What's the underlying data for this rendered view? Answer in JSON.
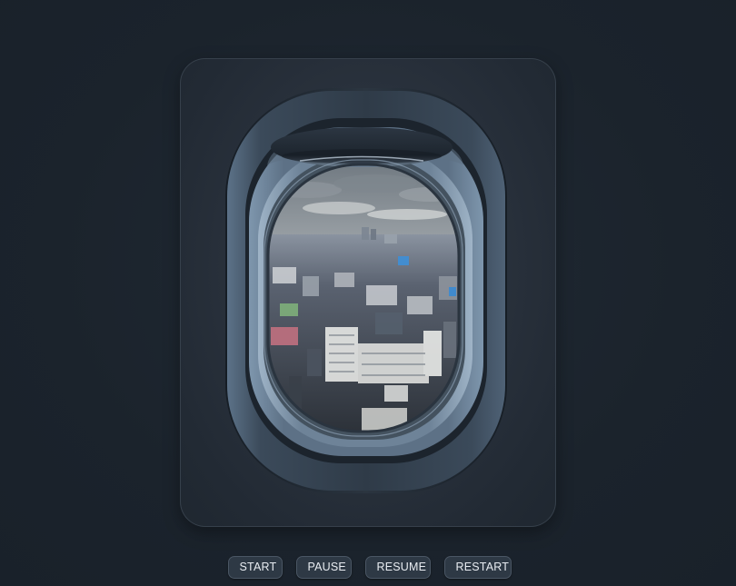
{
  "controls": {
    "start_label": "START",
    "pause_label": "PAUSE",
    "resume_label": "RESUME",
    "restart_label": "RESTART"
  },
  "colors": {
    "background": "#1b232c",
    "panel": "#2a323d",
    "button_bg": "#2e3945",
    "button_text": "#e8ecf1",
    "sky": "#aab0b4"
  }
}
